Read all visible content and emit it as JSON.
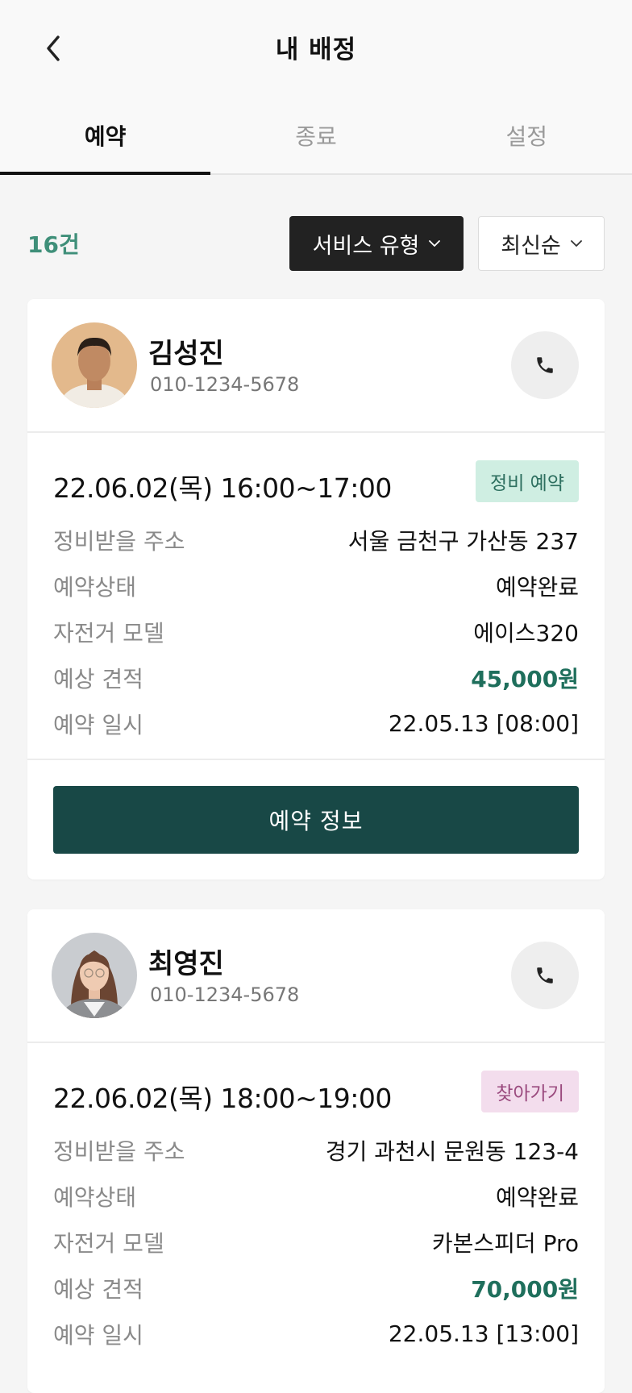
{
  "header": {
    "title": "내 배정"
  },
  "tabs": [
    {
      "label": "예약"
    },
    {
      "label": "종료"
    },
    {
      "label": "설정"
    }
  ],
  "filters": {
    "count": "16건",
    "service_type": "서비스 유형",
    "sort": "최신순"
  },
  "labels": {
    "address": "정비받을 주소",
    "status": "예약상태",
    "model": "자전거 모델",
    "estimate": "예상 견적",
    "reserved_at": "예약 일시"
  },
  "colors": {
    "accent": "#184846",
    "price": "#1f6f5c",
    "count": "#3f8f79",
    "badge_green_bg": "#cfeee2",
    "badge_pink_bg": "#f3dded"
  },
  "cards": [
    {
      "name": "김성진",
      "phone": "010-1234-5678",
      "datetime": "22.06.02(목) 16:00~17:00",
      "badge": "정비 예약",
      "address": "서울 금천구 가산동 237",
      "status": "예약완료",
      "model": "에이스320",
      "estimate": "45,000원",
      "reserved_at": "22.05.13 [08:00]",
      "action": "예약 정보"
    },
    {
      "name": "최영진",
      "phone": "010-1234-5678",
      "datetime": "22.06.02(목) 18:00~19:00",
      "badge": "찾아가기",
      "address": "경기 과천시 문원동 123-4",
      "status": "예약완료",
      "model": "카본스피더 Pro",
      "estimate": "70,000원",
      "reserved_at": "22.05.13 [13:00]"
    }
  ]
}
